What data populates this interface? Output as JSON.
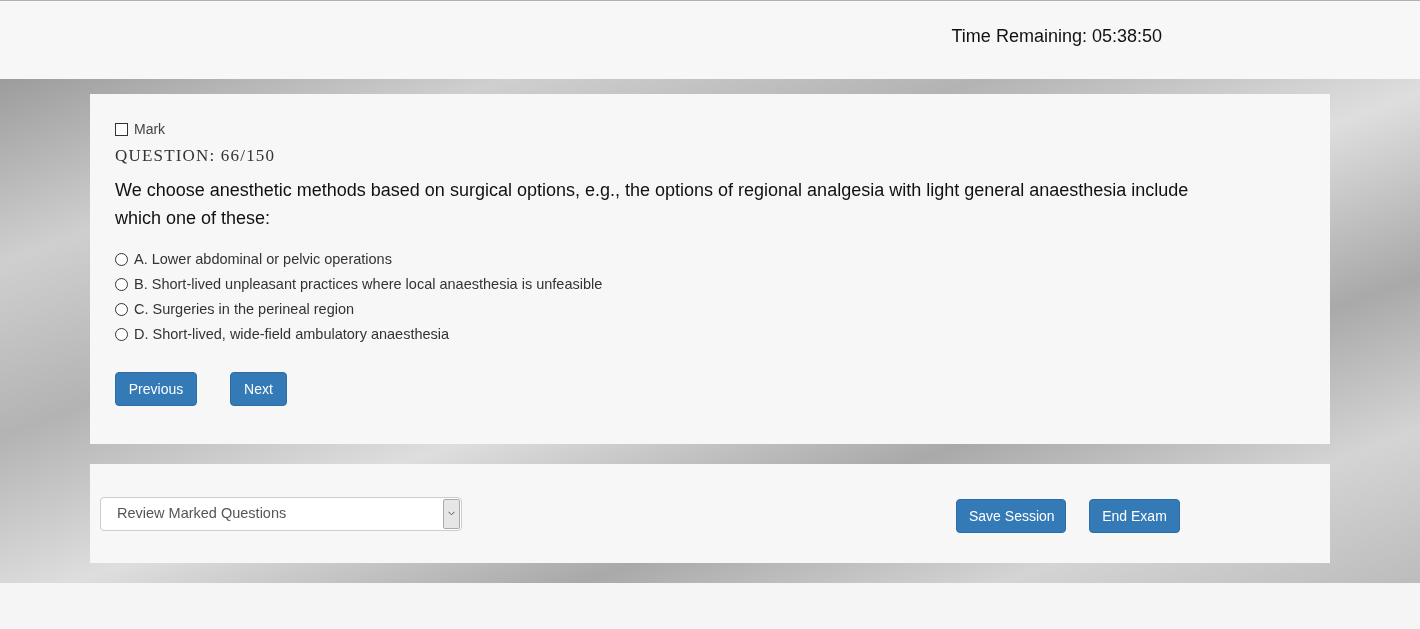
{
  "header": {
    "timer": "Time Remaining: 05:38:50"
  },
  "question": {
    "mark": {
      "label": "Mark",
      "checked": false
    },
    "number": "QUESTION: 66/150",
    "text": "We choose anesthetic methods based on surgical options, e.g., the options of regional analgesia with light general anaesthesia include which one of these:",
    "options": [
      {
        "label": "A. Lower abdominal or pelvic operations",
        "selected": false
      },
      {
        "label": "B. Short-lived unpleasant practices where local anaesthesia is unfeasible",
        "selected": false
      },
      {
        "label": "C. Surgeries in the perineal region",
        "selected": false
      },
      {
        "label": "D. Short-lived, wide-field ambulatory anaesthesia",
        "selected": false
      }
    ],
    "buttons": [
      "Previous",
      "Next"
    ]
  },
  "footer": {
    "review_select": {
      "value": "Review Marked Questions"
    },
    "buttons": [
      "Save Session",
      "End Exam"
    ]
  }
}
